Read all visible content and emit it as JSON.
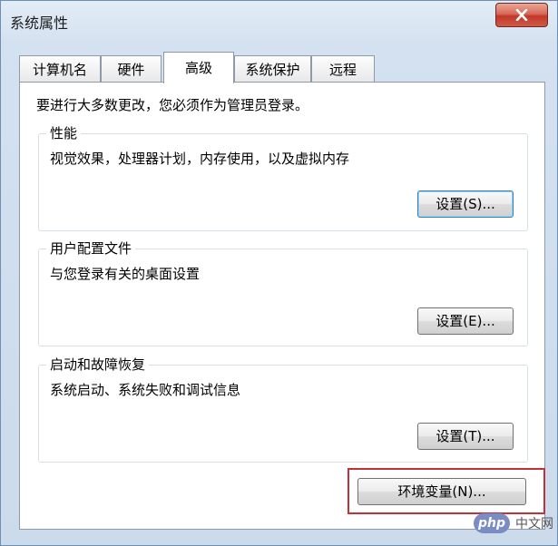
{
  "window": {
    "title": "系统属性"
  },
  "tabs": [
    {
      "label": "计算机名"
    },
    {
      "label": "硬件"
    },
    {
      "label": "高级"
    },
    {
      "label": "系统保护"
    },
    {
      "label": "远程"
    }
  ],
  "admin_note": "要进行大多数更改，您必须作为管理员登录。",
  "groups": {
    "performance": {
      "title": "性能",
      "description": "视觉效果，处理器计划，内存使用，以及虚拟内存",
      "button": "设置(S)..."
    },
    "profiles": {
      "title": "用户配置文件",
      "description": "与您登录有关的桌面设置",
      "button": "设置(E)..."
    },
    "startup": {
      "title": "启动和故障恢复",
      "description": "系统启动、系统失败和调试信息",
      "button": "设置(T)..."
    }
  },
  "env_button": "环境变量(N)...",
  "watermark": {
    "logo": "php",
    "text": "中文网"
  },
  "colors": {
    "highlight": "#c03138",
    "close_button": "#c2382a"
  }
}
